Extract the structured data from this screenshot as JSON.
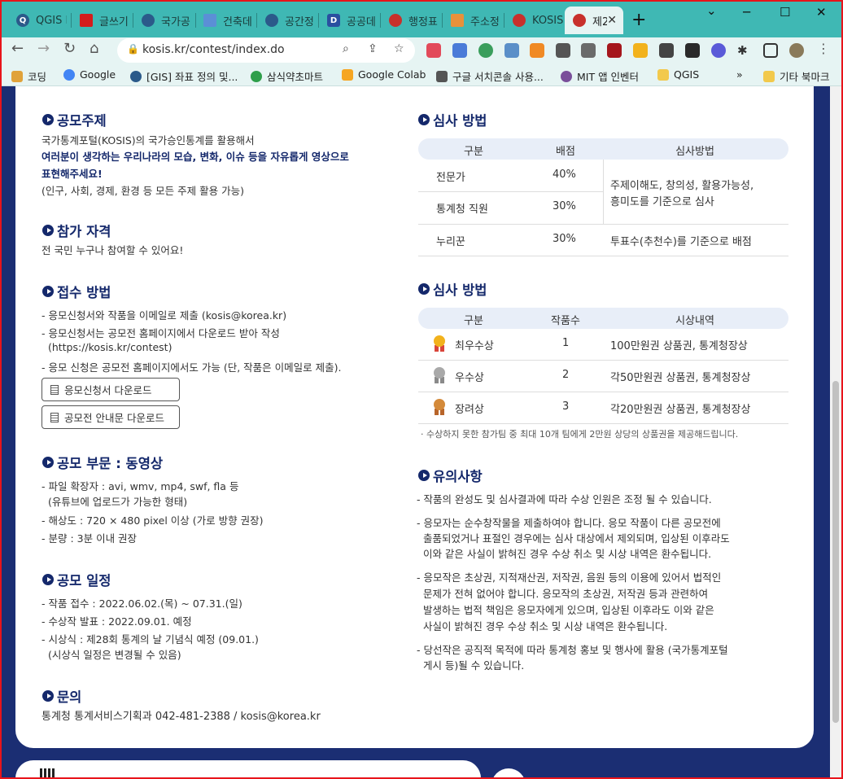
{
  "browser": {
    "tabs": [
      {
        "title": "QGIS I",
        "color": "#2b5a8a",
        "letter": "Q"
      },
      {
        "title": "글쓰기",
        "color": "#d41c1c",
        "letter": ""
      },
      {
        "title": "국가공",
        "color": "#2b5a8a",
        "letter": ""
      },
      {
        "title": "건축데",
        "color": "#5b8fd6",
        "letter": ""
      },
      {
        "title": "공간정",
        "color": "#2b5a8a",
        "letter": ""
      },
      {
        "title": "공공데",
        "color": "#2a4fa0",
        "letter": "D"
      },
      {
        "title": "행정표",
        "color": "#c8302c",
        "letter": ""
      },
      {
        "title": "주소정",
        "color": "#e8913a",
        "letter": ""
      },
      {
        "title": "KOSIS",
        "color": "#c8302c",
        "letter": ""
      },
      {
        "title": "제2",
        "color": "#c8302c",
        "letter": ""
      }
    ],
    "new_tab": "+",
    "url": "kosis.kr/contest/index.do",
    "bookmarks": [
      {
        "label": "코딩",
        "color": "#e0a23a"
      },
      {
        "label": "Google",
        "color": "#4285f4"
      },
      {
        "label": "[GIS] 좌표 정의 및...",
        "color": "#2b5a8a"
      },
      {
        "label": "삼식약초마트",
        "color": "#2e9e4a"
      },
      {
        "label": "Google Colab",
        "color": "#f6a623"
      },
      {
        "label": "구글 서치콘솔 사용...",
        "color": "#555555"
      },
      {
        "label": "MIT 앱 인벤터",
        "color": "#7a4f9a"
      },
      {
        "label": "QGIS",
        "color": "#f2c94c"
      }
    ],
    "more": "»",
    "other_bookmarks": "기타 북마크"
  },
  "left": {
    "topic": {
      "title": "공모주제",
      "line1": "국가통계포털(KOSIS)의 국가승인통계를 활용해서",
      "em1": "여러분이 생각하는 우리나라의 모습, 변화, 이슈 등을 자유롭게 영상으로",
      "em2": "표현해주세요!",
      "line2": "(인구, 사회, 경제, 환경 등 모든 주제 활용 가능)"
    },
    "eligibility": {
      "title": "참가 자격",
      "text": "전 국민 누구나 참여할 수 있어요!"
    },
    "submission": {
      "title": "접수 방법",
      "lines": [
        "- 응모신청서와 작품을 이메일로 제출 (kosis@korea.kr)",
        "- 응모신청서는 공모전 홈페이지에서 다운로드 받아 작성",
        "  (https://kosis.kr/contest)",
        "- 응모 신청은 공모전 홈페이지에서도 가능 (단, 작품은 이메일로 제출)."
      ],
      "btn_form": "응모신청서 다운로드",
      "btn_guide": "공모전 안내문 다운로드"
    },
    "category": {
      "title": "공모 부문 : 동영상",
      "lines": [
        "- 파일 확장자 : avi, wmv, mp4, swf, fla 등",
        "  (유튜브에 업로드가 가능한 형태)",
        "- 해상도 : 720 × 480 pixel 이상 (가로 방향 권장)",
        "- 분량 : 3분 이내 권장"
      ]
    },
    "schedule": {
      "title": "공모 일정",
      "lines": [
        "- 작품 접수 : 2022.06.02.(목) ~ 07.31.(일)",
        "- 수상작 발표 : 2022.09.01. 예정",
        "- 시상식 : 제28회 통계의 날 기념식 예정 (09.01.)",
        "  (시상식 일정은 변경될 수 있음)"
      ]
    },
    "contact": {
      "title": "문의",
      "text": "통계청 통계서비스기획과 042-481-2388 / kosis@korea.kr"
    }
  },
  "right": {
    "judging": {
      "title": "심사 방법",
      "headers": [
        "구분",
        "배점",
        "심사방법"
      ],
      "rows": [
        {
          "group": "전문가",
          "score": "40%"
        },
        {
          "group": "통계청 직원",
          "score": "30%"
        },
        {
          "group": "누리꾼",
          "score": "30%"
        }
      ],
      "method1a": "주제이해도, 창의성, 활용가능성,",
      "method1b": "흥미도를 기준으로 심사",
      "method2": "투표수(추천수)를 기준으로 배점"
    },
    "awards": {
      "title": "심사 방법",
      "headers": [
        "구분",
        "작품수",
        "시상내역"
      ],
      "rows": [
        {
          "name": "최우수상",
          "count": "1",
          "prize": "100만원권 상품권, 통계청장상",
          "medal": "#f2b21c"
        },
        {
          "name": "우수상",
          "count": "2",
          "prize": "각50만원권 상품권, 통계청장상",
          "medal": "#a9a9a9"
        },
        {
          "name": "장려상",
          "count": "3",
          "prize": "각20만원권 상품권, 통계청장상",
          "medal": "#d48a3a"
        }
      ],
      "note": "· 수상하지 못한 참가팀 중 최대 10개 팀에게 2만원 상당의 상품권을 제공해드립니다."
    },
    "notes": {
      "title": "유의사항",
      "lines": [
        "- 작품의 완성도 및 심사결과에 따라 수상 인원은 조정 될 수 있습니다.",
        "- 응모자는 순수창작물을 제출하여야 합니다. 응모 작품이 다른 공모전에",
        "  출품되었거나 표절인 경우에는 심사 대상에서 제외되며, 입상된 이후라도",
        "  이와 같은 사실이 밝혀진 경우 수상 취소 및 시상 내역은 환수됩니다.",
        "- 응모작은 초상권, 지적재산권, 저작권, 음원 등의 이용에 있어서 법적인",
        "  문제가 전혀 없어야 합니다. 응모작의 초상권, 저작권 등과 관련하여",
        "  발생하는 법적 책임은 응모자에게 있으며, 입상된 이후라도 이와 같은",
        "  사실이 밝혀진 경우 수상 취소 및 시상 내역은 환수됩니다.",
        "- 당선작은 공직적 목적에 따라 통계청 홍보 및 행사에 활용 (국가통계포털",
        "  게시 등)될 수 있습니다."
      ]
    }
  }
}
